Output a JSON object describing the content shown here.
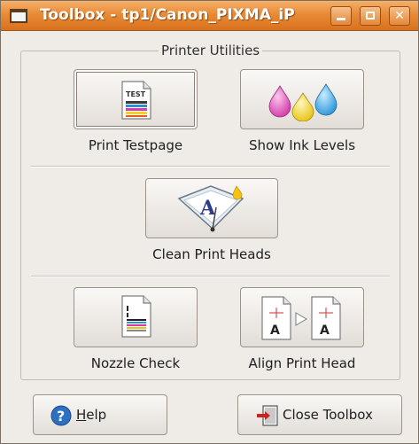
{
  "window": {
    "title": "Toolbox - tp1/Canon_PIXMA_iP",
    "colors": {
      "titlebar": "#e98b36",
      "background": "#efebe7"
    }
  },
  "frame": {
    "label": "Printer Utilities"
  },
  "tools": {
    "print_testpage": {
      "label": "Print Testpage",
      "icon": "test-page-icon",
      "icon_text": "TEST"
    },
    "show_ink_levels": {
      "label": "Show Ink Levels",
      "icon": "ink-drops-icon"
    },
    "clean_print_heads": {
      "label": "Clean Print Heads",
      "icon": "print-head-clean-icon"
    },
    "nozzle_check": {
      "label": "Nozzle Check",
      "icon": "nozzle-check-page-icon"
    },
    "align_print_head": {
      "label": "Align Print Head",
      "icon": "align-pages-icon"
    }
  },
  "buttons": {
    "help": {
      "mnemonic": "H",
      "rest": "elp",
      "icon": "help-icon"
    },
    "close": {
      "label": "Close Toolbox",
      "icon": "exit-door-icon"
    }
  }
}
